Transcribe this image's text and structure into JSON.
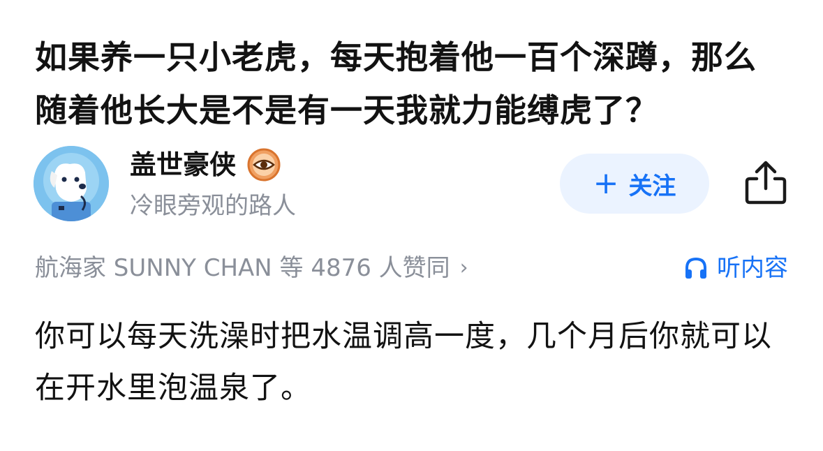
{
  "question": {
    "title": "如果养一只小老虎，每天抱着他一百个深蹲，那么随着他长大是不是有一天我就力能缚虎了？"
  },
  "author": {
    "name": "盖世豪侠",
    "bio": "冷眼旁观的路人",
    "avatar_icon": "dog-astronaut-avatar",
    "badge_icon": "eye-badge-icon"
  },
  "actions": {
    "follow_plus": "+",
    "follow_label": "关注",
    "share_icon": "share-icon"
  },
  "votes": {
    "text": "航海家 SUNNY CHAN 等 4876 人赞同",
    "chevron": "›"
  },
  "listen": {
    "label": "听内容",
    "icon": "headphones-icon"
  },
  "answer": {
    "text": "你可以每天洗澡时把水温调高一度，几个月后你就可以在开水里泡温泉了。"
  },
  "colors": {
    "accent": "#1772f6",
    "follow_bg": "#ebf3ff",
    "muted": "#8a8f99",
    "text": "#121212"
  }
}
